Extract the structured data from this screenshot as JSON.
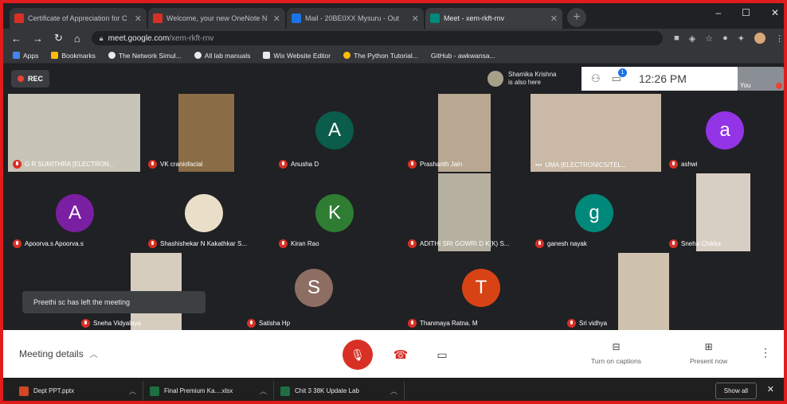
{
  "tabs": [
    {
      "title": "Certificate of Appreciation for C",
      "favicon_color": "#d93025"
    },
    {
      "title": "Welcome, your new OneNote N",
      "favicon_color": "#d93025"
    },
    {
      "title": "Mail - 20BE0XX Mysuru - Out",
      "favicon_color": "#1a73e8"
    },
    {
      "title": "Meet - xem-rkft-rnv",
      "favicon_color": "#00897b"
    }
  ],
  "window_controls": {
    "minimize": "–",
    "maximize": "☐",
    "close": "✕"
  },
  "address": {
    "host": "meet.google.com",
    "path": "/xem-rkft-rnv"
  },
  "bookmarks": [
    {
      "label": "Apps",
      "color": "#4285f4"
    },
    {
      "label": "Bookmarks",
      "color": "#fbbc04"
    },
    {
      "label": "The Network Simul...",
      "color": "#e8eaed"
    },
    {
      "label": "All lab manuals",
      "color": "#e8eaed"
    },
    {
      "label": "Wix Website Editor",
      "color": "#e8eaed"
    },
    {
      "label": "The Python Tutorial...",
      "color": "#fbbc04"
    },
    {
      "label": "GitHub - awkwansa...",
      "color": "#e8eaed"
    }
  ],
  "meet": {
    "rec_label": "REC",
    "join_note": {
      "name": "Shamika Krishna",
      "text": "is also here"
    },
    "participants_badge": "1",
    "clock": "12:26 PM",
    "self_label": "You",
    "toast": "Preethi sc has left the meeting"
  },
  "tiles": [
    {
      "name": "G R SUMITHRA [ELECTRON...",
      "kind": "video",
      "vid_color": "#c9c4b8"
    },
    {
      "name": "VK craniofacial",
      "kind": "video",
      "vid_color": "#8a6d46"
    },
    {
      "name": "Anusha D",
      "kind": "avatar",
      "letter": "A",
      "color": "#0b5c4a"
    },
    {
      "name": "Prashanth Jain",
      "kind": "video",
      "vid_color": "#b8a892"
    },
    {
      "name": "UMA [ELECTRONICS/TEL...",
      "kind": "video",
      "vid_color": "#c9b9a6"
    },
    {
      "name": "ashwi",
      "kind": "avatar",
      "letter": "a",
      "color": "#9334e6"
    },
    {
      "name": "Apoorva.s Apoorva.s",
      "kind": "avatar",
      "letter": "A",
      "color": "#7b1fa2"
    },
    {
      "name": "Shashishekar N Kakathkar S...",
      "kind": "photo",
      "vid_color": "#e9dfc8"
    },
    {
      "name": "Kiran Rao",
      "kind": "avatar",
      "letter": "K",
      "color": "#2e7d32"
    },
    {
      "name": "ADITHI SRI GOWRI D K(K) S...",
      "kind": "video",
      "vid_color": "#b5b0a0"
    },
    {
      "name": "ganesh nayak",
      "kind": "avatar",
      "letter": "g",
      "color": "#00897b"
    },
    {
      "name": "Sneha Chikka",
      "kind": "video",
      "vid_color": "#d8cfc4"
    },
    {
      "name": "Sneha Vidyalaya",
      "kind": "video",
      "vid_color": "#d6cdbf"
    },
    {
      "name": "Satisha Hp",
      "kind": "avatar",
      "letter": "S",
      "color": "#8d6e63"
    },
    {
      "name": "Thanmaya Ratna. M",
      "kind": "avatar",
      "letter": "T",
      "color": "#d84315"
    },
    {
      "name": "Sri vidhya",
      "kind": "video",
      "vid_color": "#cfc2ae"
    }
  ],
  "controls": {
    "meeting_details": "Meeting details",
    "captions": "Turn on captions",
    "present": "Present now"
  },
  "downloads": [
    {
      "name": "Dept PPT.pptx",
      "color": "#d24726"
    },
    {
      "name": "Final Premium Ka....xlsx",
      "color": "#1d6f42"
    },
    {
      "name": "Chit 3 38K Update Lab",
      "color": "#1d6f42"
    }
  ],
  "show_all": "Show all"
}
